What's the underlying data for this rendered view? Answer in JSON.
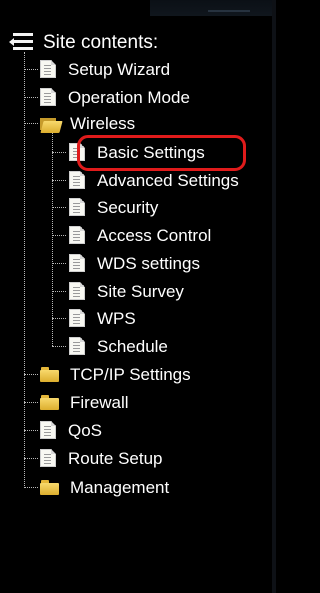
{
  "tree": {
    "root_label": "Site contents:",
    "items": [
      {
        "label": "Setup Wizard",
        "icon": "document-icon"
      },
      {
        "label": "Operation Mode",
        "icon": "document-icon"
      },
      {
        "label": "Wireless",
        "icon": "folder-open-icon",
        "expanded": true
      },
      {
        "label": "TCP/IP Settings",
        "icon": "folder-icon"
      },
      {
        "label": "Firewall",
        "icon": "folder-icon"
      },
      {
        "label": "QoS",
        "icon": "document-icon"
      },
      {
        "label": "Route Setup",
        "icon": "document-icon"
      },
      {
        "label": "Management",
        "icon": "folder-icon"
      }
    ],
    "wireless_children": [
      {
        "label": "Basic Settings",
        "icon": "document-icon",
        "selected": true
      },
      {
        "label": "Advanced Settings",
        "icon": "document-icon"
      },
      {
        "label": "Security",
        "icon": "document-icon"
      },
      {
        "label": "Access Control",
        "icon": "document-icon"
      },
      {
        "label": "WDS settings",
        "icon": "document-icon"
      },
      {
        "label": "Site Survey",
        "icon": "document-icon"
      },
      {
        "label": "WPS",
        "icon": "document-icon"
      },
      {
        "label": "Schedule",
        "icon": "document-icon"
      }
    ]
  },
  "colors": {
    "background": "#000000",
    "text": "#ffffff",
    "highlight": "#e01b1b",
    "folder": "#e6b83a"
  }
}
